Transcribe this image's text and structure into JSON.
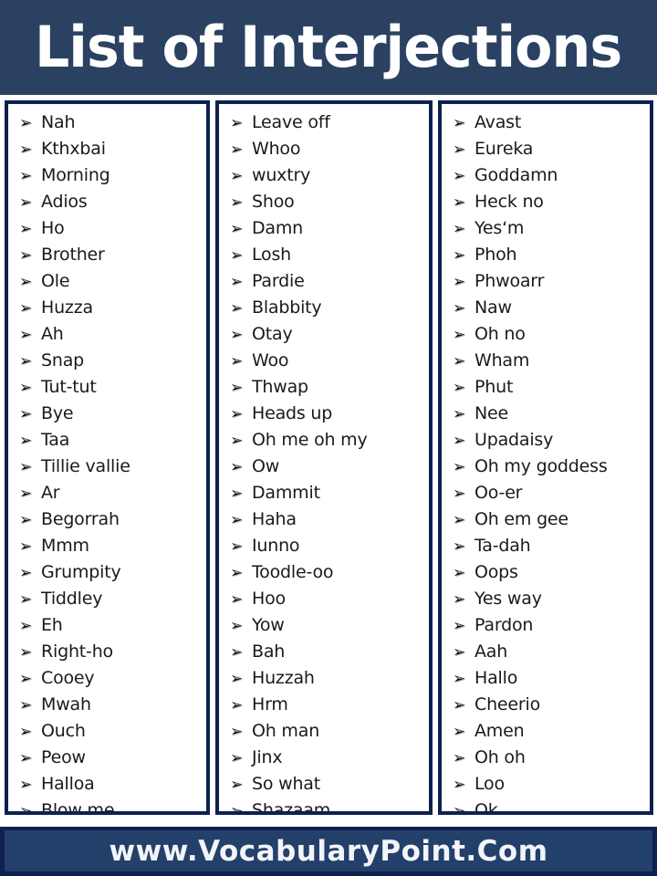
{
  "header": {
    "title": "List of Interjections",
    "background_color": "#2a4162",
    "text_color": "#ffffff"
  },
  "theme": {
    "box_border_color": "#0d2150",
    "footer_border_color": "#0e2150",
    "footer_fill_color": "#23406b",
    "page_background": "#ffffff",
    "text_color": "#1a1a1a"
  },
  "bullet": {
    "glyph": "➢",
    "icon_name": "arrowhead-bullet-icon"
  },
  "columns": [
    {
      "name": "column-1",
      "items": [
        "Nah",
        "Kthxbai",
        "Morning",
        "Adios",
        "Ho",
        "Brother",
        "Ole",
        "Huzza",
        "Ah",
        "Snap",
        "Tut-tut",
        "Bye",
        "Taa",
        "Tillie vallie",
        "Ar",
        "Begorrah",
        "Mmm",
        "Grumpity",
        "Tiddley",
        "Eh",
        "Right-ho",
        "Cooey",
        "Mwah",
        "Ouch",
        "Peow",
        "Halloa",
        "Blow me"
      ]
    },
    {
      "name": "column-2",
      "items": [
        "Leave off",
        "Whoo",
        "wuxtry",
        "Shoo",
        "Damn",
        "Losh",
        "Pardie",
        "Blabbity",
        "Otay",
        "Woo",
        "Thwap",
        "Heads up",
        "Oh me oh my",
        "Ow",
        "Dammit",
        "Haha",
        "Iunno",
        "Toodle-oo",
        "Hoo",
        "Yow",
        "Bah",
        "Huzzah",
        "Hrm",
        "Oh man",
        "Jinx",
        "So what",
        "Shazaam"
      ]
    },
    {
      "name": "column-3",
      "items": [
        "Avast",
        "Eureka",
        "Goddamn",
        "Heck no",
        "Yes‘m",
        "Phoh",
        "Phwoarr",
        "Naw",
        "Oh no",
        "Wham",
        "Phut",
        "Nee",
        "Upadaisy",
        "Oh my goddess",
        "Oo-er",
        "Oh em gee",
        "Ta-dah",
        "Oops",
        "Yes way",
        "Pardon",
        "Aah",
        "Hallo",
        "Cheerio",
        "Amen",
        "Oh oh",
        "Loo",
        "Ok"
      ]
    }
  ],
  "footer": {
    "text": "www.VocabularyPoint.Com"
  }
}
